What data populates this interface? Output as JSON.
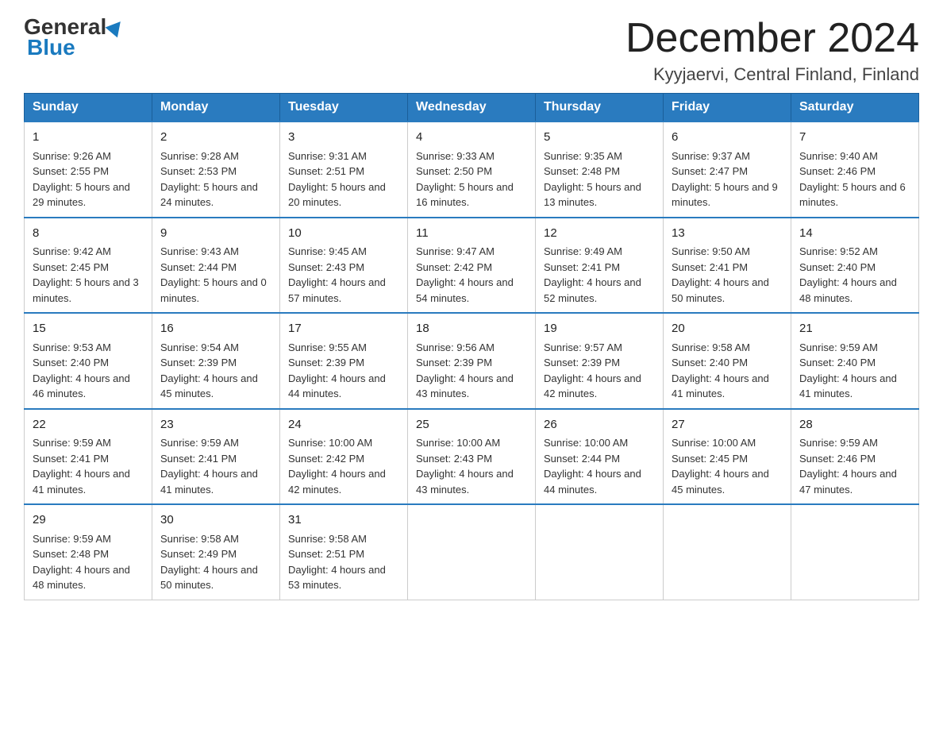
{
  "header": {
    "logo_general": "General",
    "logo_blue": "Blue",
    "month_title": "December 2024",
    "location": "Kyyjaervi, Central Finland, Finland"
  },
  "weekdays": [
    "Sunday",
    "Monday",
    "Tuesday",
    "Wednesday",
    "Thursday",
    "Friday",
    "Saturday"
  ],
  "weeks": [
    [
      {
        "day": "1",
        "sunrise": "9:26 AM",
        "sunset": "2:55 PM",
        "daylight": "5 hours and 29 minutes."
      },
      {
        "day": "2",
        "sunrise": "9:28 AM",
        "sunset": "2:53 PM",
        "daylight": "5 hours and 24 minutes."
      },
      {
        "day": "3",
        "sunrise": "9:31 AM",
        "sunset": "2:51 PM",
        "daylight": "5 hours and 20 minutes."
      },
      {
        "day": "4",
        "sunrise": "9:33 AM",
        "sunset": "2:50 PM",
        "daylight": "5 hours and 16 minutes."
      },
      {
        "day": "5",
        "sunrise": "9:35 AM",
        "sunset": "2:48 PM",
        "daylight": "5 hours and 13 minutes."
      },
      {
        "day": "6",
        "sunrise": "9:37 AM",
        "sunset": "2:47 PM",
        "daylight": "5 hours and 9 minutes."
      },
      {
        "day": "7",
        "sunrise": "9:40 AM",
        "sunset": "2:46 PM",
        "daylight": "5 hours and 6 minutes."
      }
    ],
    [
      {
        "day": "8",
        "sunrise": "9:42 AM",
        "sunset": "2:45 PM",
        "daylight": "5 hours and 3 minutes."
      },
      {
        "day": "9",
        "sunrise": "9:43 AM",
        "sunset": "2:44 PM",
        "daylight": "5 hours and 0 minutes."
      },
      {
        "day": "10",
        "sunrise": "9:45 AM",
        "sunset": "2:43 PM",
        "daylight": "4 hours and 57 minutes."
      },
      {
        "day": "11",
        "sunrise": "9:47 AM",
        "sunset": "2:42 PM",
        "daylight": "4 hours and 54 minutes."
      },
      {
        "day": "12",
        "sunrise": "9:49 AM",
        "sunset": "2:41 PM",
        "daylight": "4 hours and 52 minutes."
      },
      {
        "day": "13",
        "sunrise": "9:50 AM",
        "sunset": "2:41 PM",
        "daylight": "4 hours and 50 minutes."
      },
      {
        "day": "14",
        "sunrise": "9:52 AM",
        "sunset": "2:40 PM",
        "daylight": "4 hours and 48 minutes."
      }
    ],
    [
      {
        "day": "15",
        "sunrise": "9:53 AM",
        "sunset": "2:40 PM",
        "daylight": "4 hours and 46 minutes."
      },
      {
        "day": "16",
        "sunrise": "9:54 AM",
        "sunset": "2:39 PM",
        "daylight": "4 hours and 45 minutes."
      },
      {
        "day": "17",
        "sunrise": "9:55 AM",
        "sunset": "2:39 PM",
        "daylight": "4 hours and 44 minutes."
      },
      {
        "day": "18",
        "sunrise": "9:56 AM",
        "sunset": "2:39 PM",
        "daylight": "4 hours and 43 minutes."
      },
      {
        "day": "19",
        "sunrise": "9:57 AM",
        "sunset": "2:39 PM",
        "daylight": "4 hours and 42 minutes."
      },
      {
        "day": "20",
        "sunrise": "9:58 AM",
        "sunset": "2:40 PM",
        "daylight": "4 hours and 41 minutes."
      },
      {
        "day": "21",
        "sunrise": "9:59 AM",
        "sunset": "2:40 PM",
        "daylight": "4 hours and 41 minutes."
      }
    ],
    [
      {
        "day": "22",
        "sunrise": "9:59 AM",
        "sunset": "2:41 PM",
        "daylight": "4 hours and 41 minutes."
      },
      {
        "day": "23",
        "sunrise": "9:59 AM",
        "sunset": "2:41 PM",
        "daylight": "4 hours and 41 minutes."
      },
      {
        "day": "24",
        "sunrise": "10:00 AM",
        "sunset": "2:42 PM",
        "daylight": "4 hours and 42 minutes."
      },
      {
        "day": "25",
        "sunrise": "10:00 AM",
        "sunset": "2:43 PM",
        "daylight": "4 hours and 43 minutes."
      },
      {
        "day": "26",
        "sunrise": "10:00 AM",
        "sunset": "2:44 PM",
        "daylight": "4 hours and 44 minutes."
      },
      {
        "day": "27",
        "sunrise": "10:00 AM",
        "sunset": "2:45 PM",
        "daylight": "4 hours and 45 minutes."
      },
      {
        "day": "28",
        "sunrise": "9:59 AM",
        "sunset": "2:46 PM",
        "daylight": "4 hours and 47 minutes."
      }
    ],
    [
      {
        "day": "29",
        "sunrise": "9:59 AM",
        "sunset": "2:48 PM",
        "daylight": "4 hours and 48 minutes."
      },
      {
        "day": "30",
        "sunrise": "9:58 AM",
        "sunset": "2:49 PM",
        "daylight": "4 hours and 50 minutes."
      },
      {
        "day": "31",
        "sunrise": "9:58 AM",
        "sunset": "2:51 PM",
        "daylight": "4 hours and 53 minutes."
      },
      null,
      null,
      null,
      null
    ]
  ]
}
